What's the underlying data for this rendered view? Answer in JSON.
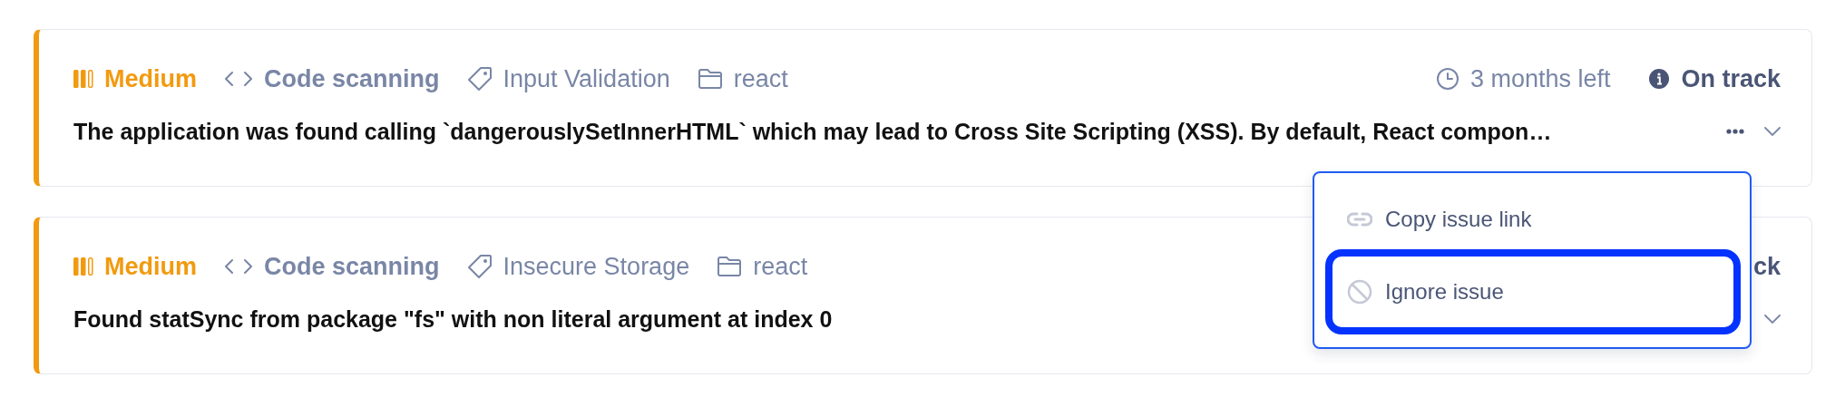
{
  "issues": [
    {
      "severity": {
        "kind": "medium",
        "label": "Medium",
        "level": 0.67
      },
      "source": "Code scanning",
      "category": "Input Validation",
      "project": "react",
      "time_left": "3 months left",
      "status": "On track",
      "status_icon": true,
      "more_menu": true,
      "description": "The application was found calling `dangerouslySetInnerHTML` which may lead to Cross Site Scripting (XSS). By default, React compon…"
    },
    {
      "severity": {
        "kind": "medium",
        "label": "Medium",
        "level": 0.67
      },
      "source": "Code scanning",
      "category": "Insecure Storage",
      "project": "react",
      "status": "ck",
      "status_icon": false,
      "more_menu": false,
      "description": "Found statSync from package \"fs\" with non literal argument at index 0"
    }
  ],
  "menu": {
    "items": [
      {
        "kind": "link",
        "label": "Copy issue link",
        "selected": false
      },
      {
        "kind": "ignore",
        "label": "Ignore issue",
        "selected": true
      }
    ]
  }
}
